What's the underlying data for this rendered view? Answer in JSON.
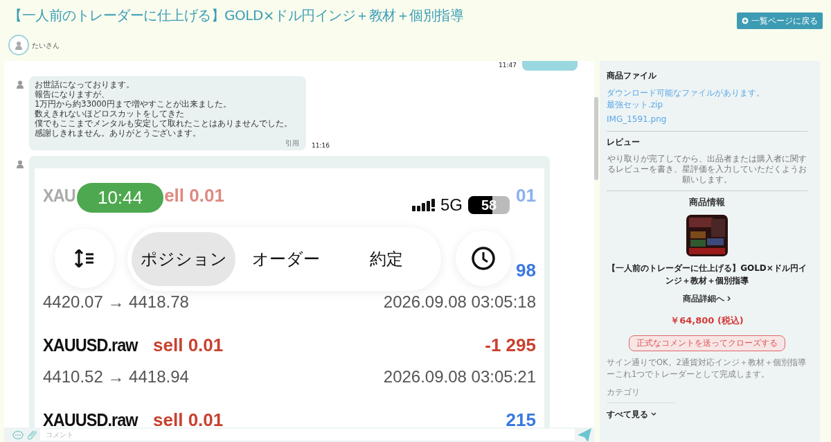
{
  "header": {
    "title": "【一人前のトレーダーに仕上げる】GOLD×ドル円インジ＋教材＋個別指導",
    "back_button": "一覧ページに戻る",
    "user": "たいさん"
  },
  "chat": {
    "previous_time": "11:47",
    "messages": [
      {
        "kind": "text",
        "lines": [
          "お世話になっております。",
          "報告になりますが、",
          "1万円から約33000円まで増やすことが出来ました。",
          "数えきれないほどロスカットをしてきた",
          "僕でもここまでメンタルも安定して取れたことはありませんでした。",
          "感謝しきれません。ありがとうございます。"
        ],
        "quote": "引用",
        "time": "11:16"
      },
      {
        "kind": "screenshot",
        "status": {
          "time": "10:44",
          "network": "5G",
          "battery": "58",
          "level": 0.58
        },
        "tabs": [
          {
            "label": "ポジション",
            "selected": true
          },
          {
            "label": "オーダー",
            "selected": false
          },
          {
            "label": "約定",
            "selected": false
          }
        ],
        "rows": [
          {
            "symbol": "XAU",
            "side": "ell 0.01",
            "profit": "01",
            "positive": true,
            "faded": true
          },
          {
            "profit": "98",
            "positive": true,
            "faded": false,
            "prices": "4420.07 → 4418.78",
            "time": "2026.09.08 03:05:18"
          },
          {
            "symbol": "XAUUSD.raw",
            "side": "sell 0.01",
            "profit": "-1 295",
            "positive": false,
            "faded": false,
            "prices": "4410.52 → 4418.94",
            "time": "2026.09.08 03:05:21"
          },
          {
            "symbol": "XAUUSD.raw",
            "side": "sell 0.01",
            "profit": "215",
            "positive": true,
            "faded": false
          }
        ]
      }
    ],
    "comment_placeholder": "コメント"
  },
  "sidebar": {
    "files_heading": "商品ファイル",
    "files": [
      "ダウンロード可能なファイルがあります。",
      "最強セット.zip",
      "IMG_1591.png"
    ],
    "review_heading": "レビュー",
    "review_text": "やり取りが完了してから、出品者または購入者に関するレビューを書き、星評価を入力していただくようお願いします。",
    "info_heading": "商品情報",
    "product_title": "【一人前のトレーダーに仕上げる】GOLD×ドル円インジ＋教材＋個別指導",
    "details_link": "商品詳細へ",
    "price": "￥64,800 (税込)",
    "close_button": "正式なコメントを送ってクローズする",
    "description": "サイン通りでOK。2通貨対応インジ＋教材＋個別指導ーこれ1つでトレーダーとして完成します。",
    "category_label": "カテゴリ",
    "see_all": "すべて見る"
  }
}
